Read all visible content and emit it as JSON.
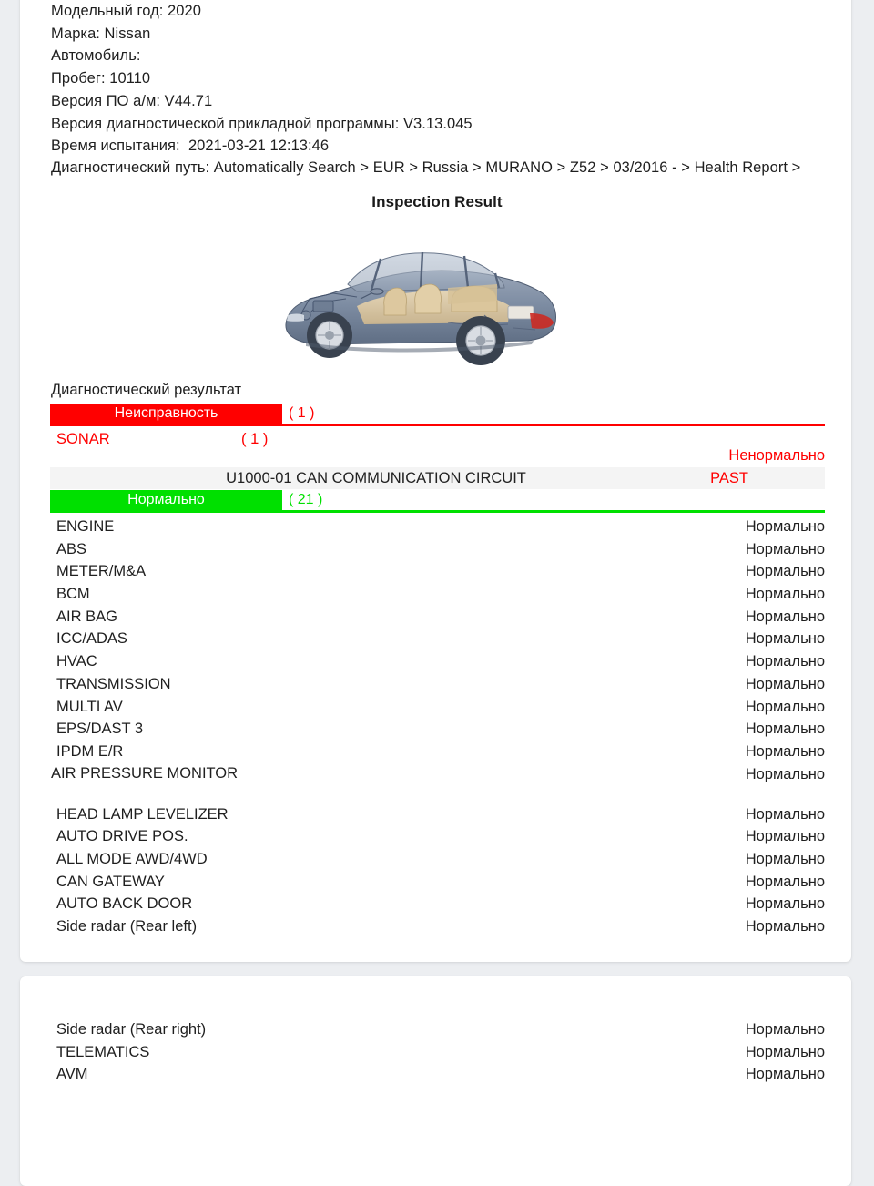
{
  "header": {
    "lines": [
      "Модельный год: 2020",
      "Марка: Nissan",
      "Автомобиль:",
      "Пробег: 10110",
      "Версия ПО а/м: V44.71",
      "Версия диагностической прикладной программы: V3.13.045",
      "Время испытания:  2021-03-21 12:13:46"
    ],
    "path_line": "Диагностический путь: Automatically Search > EUR > Russia > MURANO > Z52 > 03/2016 - > Health Report >"
  },
  "inspection": {
    "title": "Inspection Result",
    "car_illustration_alt": "cutaway-sedan-illustration"
  },
  "diagnostic": {
    "section_label": "Диагностический результат",
    "fault_bar": {
      "label": "Неисправность",
      "count": "( 1 )",
      "color": "#ff0000"
    },
    "normal_bar": {
      "label": "Нормально",
      "count": "( 21 )",
      "color": "#00e000"
    },
    "fault_system": {
      "name": "SONAR",
      "count": "( 1 )",
      "abnormal_label": "Ненормально",
      "dtc_code": "U1000-01 CAN COMMUNICATION CIRCUIT",
      "dtc_status": "PAST"
    }
  },
  "modules_page1": [
    {
      "name": "ENGINE",
      "status": "Нормально"
    },
    {
      "name": "ABS",
      "status": "Нормально"
    },
    {
      "name": "METER/M&A",
      "status": "Нормально"
    },
    {
      "name": "BCM",
      "status": "Нормально"
    },
    {
      "name": "AIR BAG",
      "status": "Нормально"
    },
    {
      "name": "ICC/ADAS",
      "status": "Нормально"
    },
    {
      "name": "HVAC",
      "status": "Нормально"
    },
    {
      "name": "TRANSMISSION",
      "status": "Нормально"
    },
    {
      "name": "MULTI AV",
      "status": "Нормально"
    },
    {
      "name": "EPS/DAST 3",
      "status": "Нормально"
    },
    {
      "name": "IPDM E/R",
      "status": "Нормально"
    },
    {
      "name": "AIR PRESSURE MONITOR",
      "status": "Нормально"
    },
    {
      "name": "HEAD LAMP LEVELIZER",
      "status": "Нормально"
    },
    {
      "name": "AUTO DRIVE POS.",
      "status": "Нормально"
    },
    {
      "name": "ALL MODE AWD/4WD",
      "status": "Нормально"
    },
    {
      "name": "CAN GATEWAY",
      "status": "Нормально"
    },
    {
      "name": "AUTO BACK DOOR",
      "status": "Нормально"
    },
    {
      "name": "Side radar (Rear left)",
      "status": "Нормально"
    }
  ],
  "modules_page2": [
    {
      "name": "Side radar (Rear right)",
      "status": "Нормально"
    },
    {
      "name": "TELEMATICS",
      "status": "Нормально"
    },
    {
      "name": "AVM",
      "status": "Нормально"
    }
  ]
}
